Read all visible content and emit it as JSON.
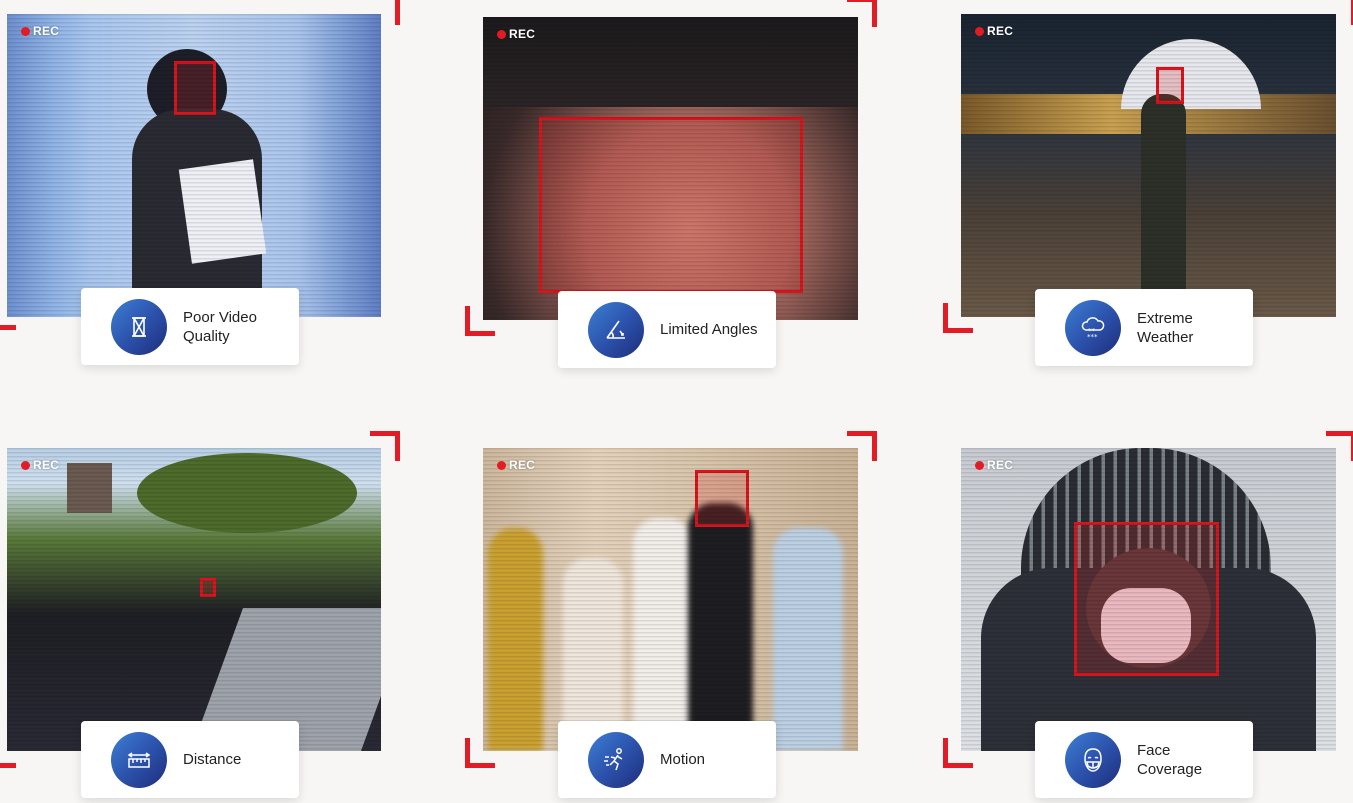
{
  "rec_label": "REC",
  "accent_color": "#e21c24",
  "tiles": [
    {
      "id": "poor-video-quality",
      "label": "Poor Video Quality",
      "icon": "hourglass-icon"
    },
    {
      "id": "limited-angles",
      "label": "Limited Angles",
      "icon": "angle-icon"
    },
    {
      "id": "extreme-weather",
      "label": "Extreme Weather",
      "icon": "snow-cloud-icon"
    },
    {
      "id": "distance",
      "label": "Distance",
      "icon": "ruler-icon"
    },
    {
      "id": "motion",
      "label": "Motion",
      "icon": "running-person-icon"
    },
    {
      "id": "face-coverage",
      "label": "Face Coverage",
      "icon": "masked-face-icon"
    }
  ]
}
